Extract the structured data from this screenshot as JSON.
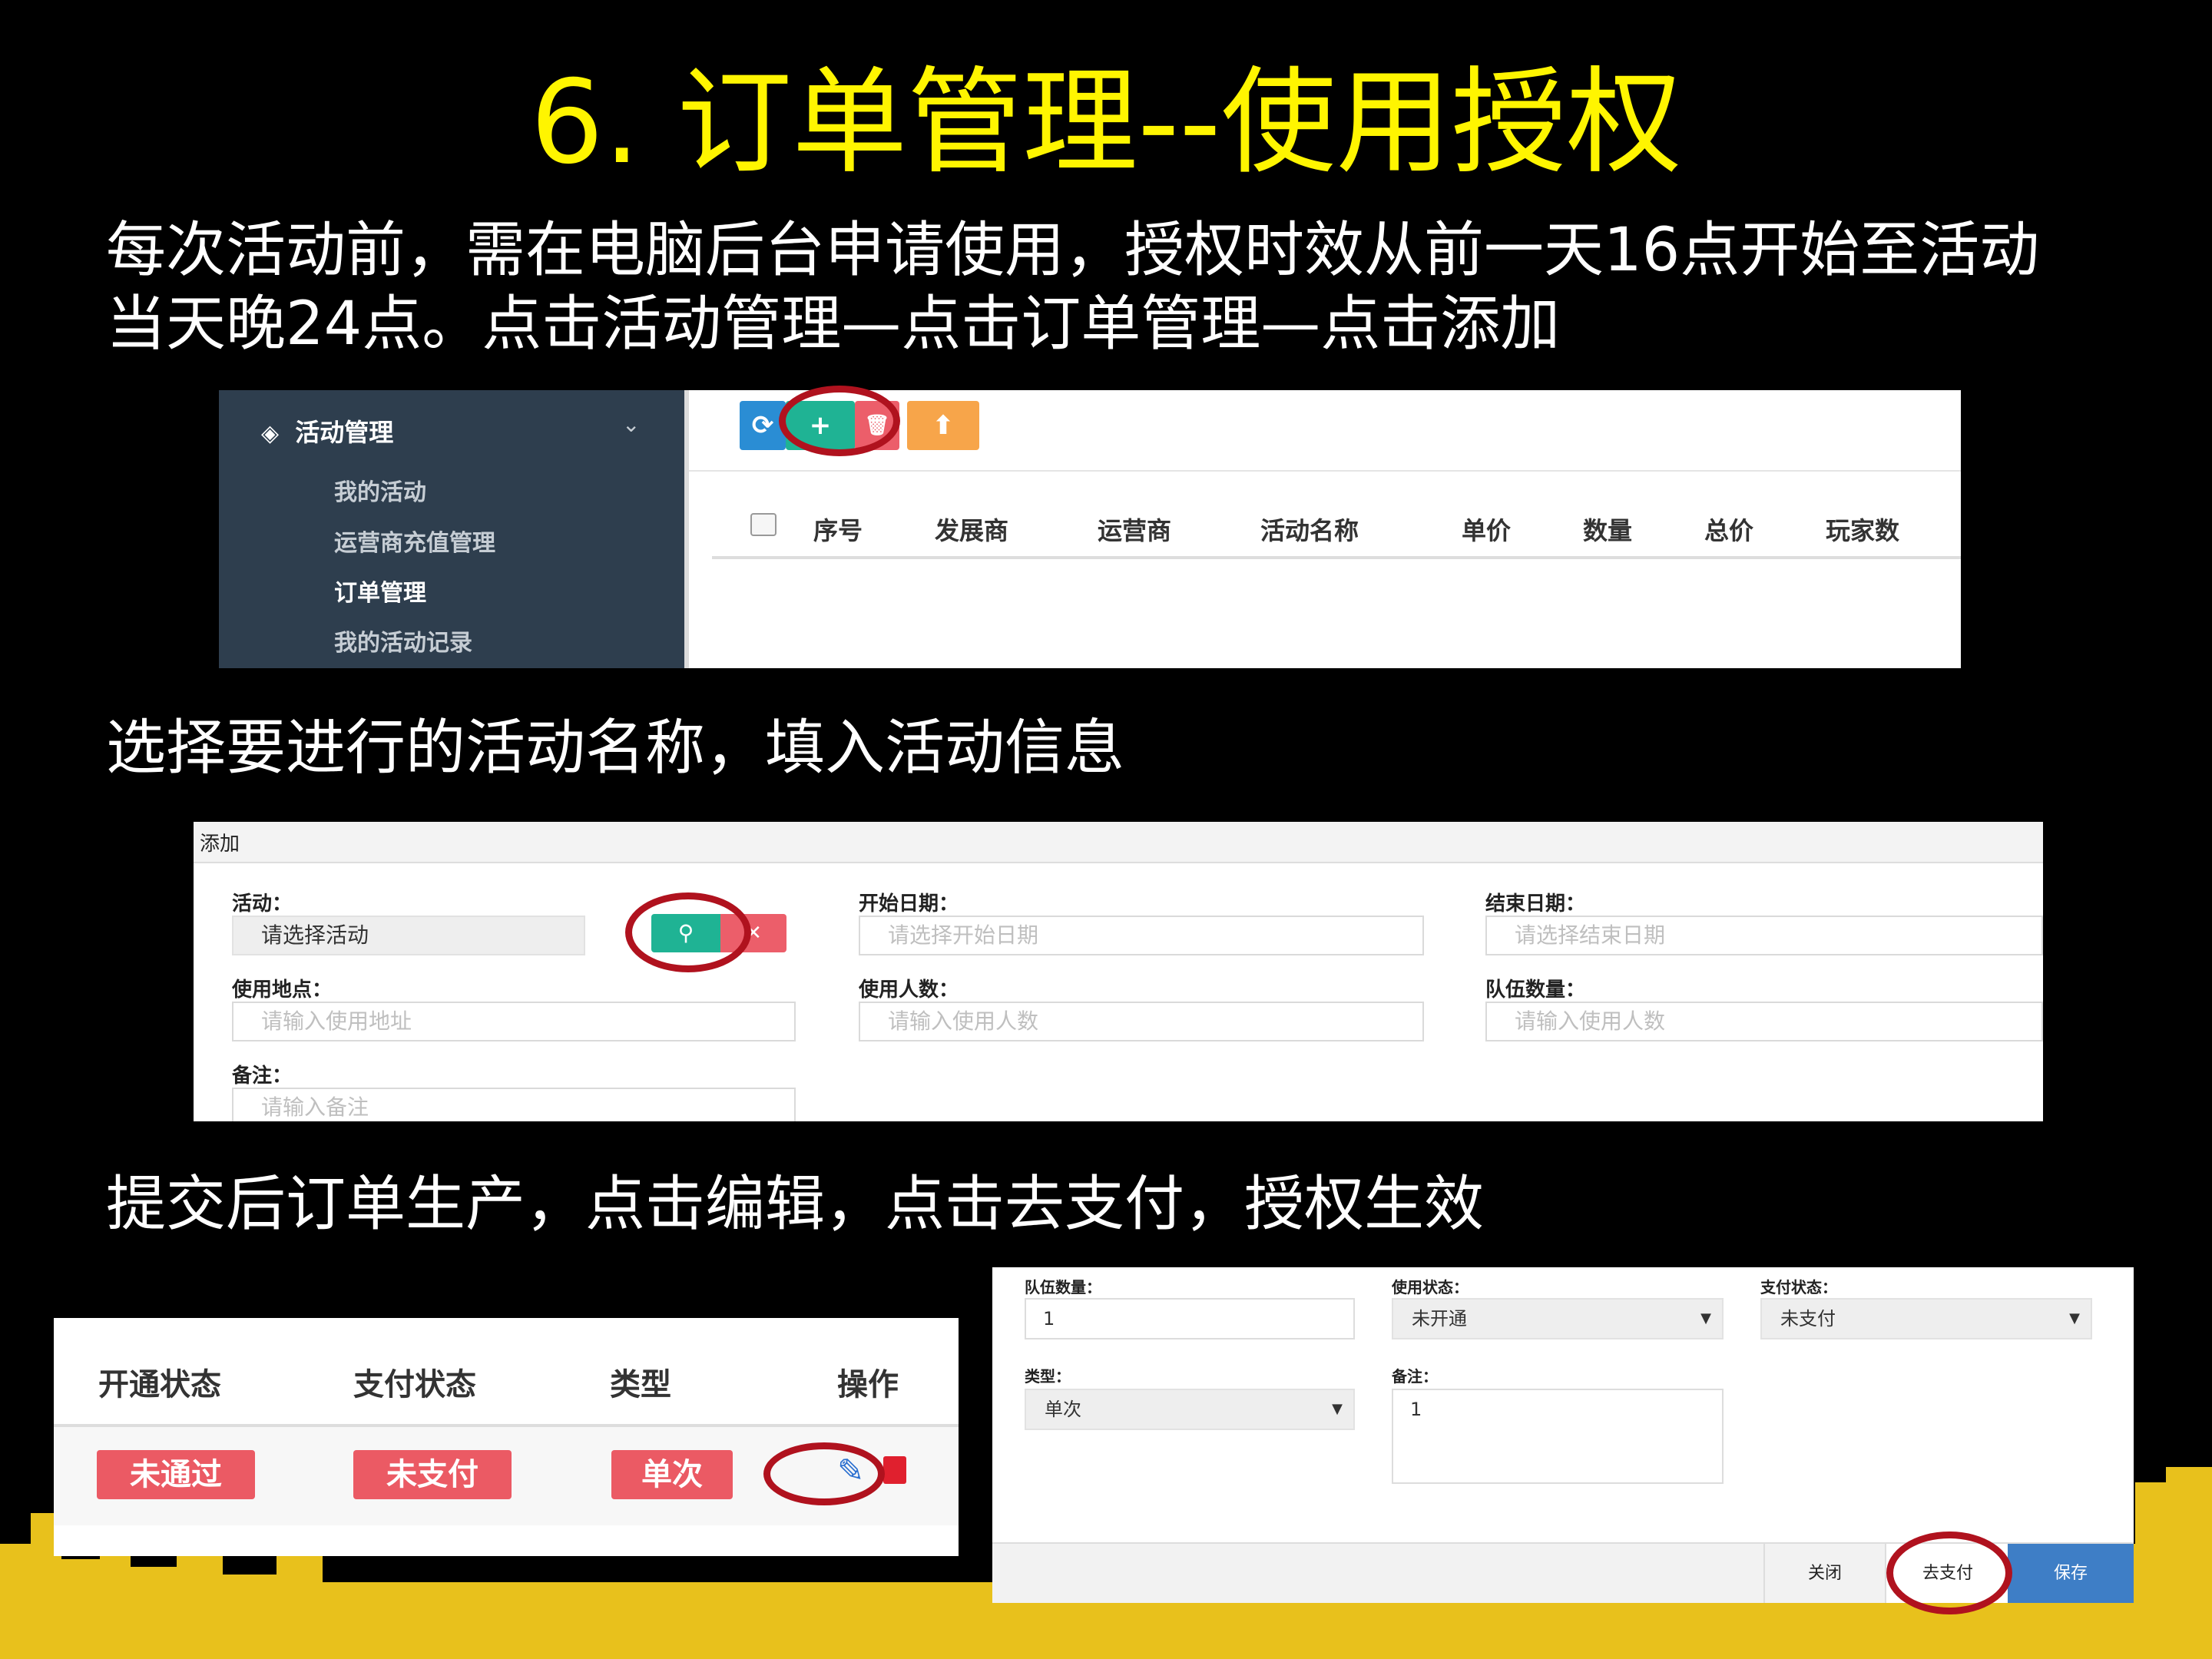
{
  "slide": {
    "title": "6. 订单管理--使用授权",
    "intro_line1": "每次活动前，需在电脑后台申请使用，授权时效从前一天16点开始至活动",
    "intro_line2": "当天晚24点。点击活动管理—点击订单管理—点击添加",
    "step2": "选择要进行的活动名称，填入活动信息",
    "step3": "提交后订单生产，点击编辑，点击去支付，授权生效",
    "colors": {
      "title": "#FFF500",
      "highlight_ring": "#B0121E",
      "skyline": "#E8C11C"
    }
  },
  "panel_order_list": {
    "sidebar": {
      "section": "活动管理",
      "items": [
        "我的活动",
        "运营商充值管理",
        "订单管理",
        "我的活动记录"
      ]
    },
    "toolbar": {
      "refresh": "⟳",
      "add": "+",
      "delete": "🗑",
      "export": "⬆"
    },
    "columns": [
      "序号",
      "发展商",
      "运营商",
      "活动名称",
      "单价",
      "数量",
      "总价",
      "玩家数"
    ]
  },
  "panel_add_form": {
    "header": "添加",
    "activity_label": "活动：",
    "activity_value": "请选择活动",
    "start_label": "开始日期：",
    "start_placeholder": "请选择开始日期",
    "end_label": "结束日期：",
    "end_placeholder": "请选择结束日期",
    "place_label": "使用地点：",
    "place_placeholder": "请输入使用地址",
    "people_label": "使用人数：",
    "people_placeholder": "请输入使用人数",
    "team_label": "队伍数量：",
    "team_placeholder": "请输入使用人数",
    "note_label": "备注：",
    "note_placeholder": "请输入备注"
  },
  "panel_status_row": {
    "columns": [
      "开通状态",
      "支付状态",
      "类型",
      "操作"
    ],
    "open_status": "未通过",
    "pay_status": "未支付",
    "type": "单次"
  },
  "panel_edit_dialog": {
    "team_label": "队伍数量：",
    "team_value": "1",
    "use_status_label": "使用状态：",
    "use_status_value": "未开通",
    "pay_status_label": "支付状态：",
    "pay_status_value": "未支付",
    "type_label": "类型：",
    "type_value": "单次",
    "note_label": "备注：",
    "note_value": "1",
    "close_button": "关闭",
    "pay_button": "去支付",
    "save_button": "保存"
  }
}
